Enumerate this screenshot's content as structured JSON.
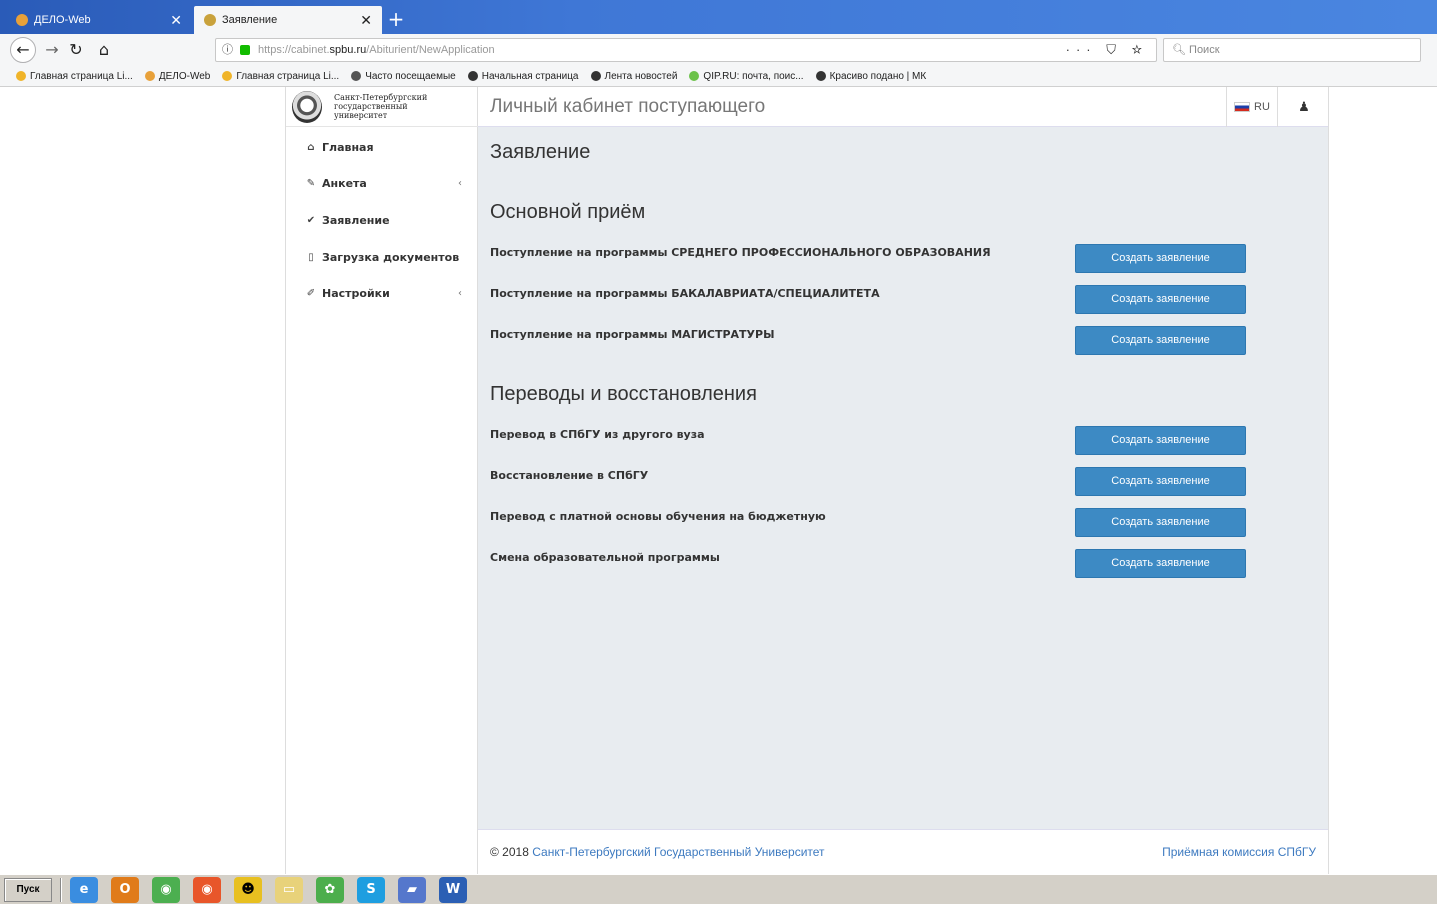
{
  "browser": {
    "tabs": [
      {
        "title": "ДЕЛО-Web",
        "active": false,
        "icon": "delo-icon"
      },
      {
        "title": "Заявление",
        "active": true,
        "icon": "spbu-crest-icon"
      }
    ],
    "url_prefix": "https://cabinet.",
    "url_host": "spbu.ru",
    "url_path": "/Abiturient/NewApplication",
    "search_placeholder": "Поиск",
    "bookmarks": [
      "Главная страница Li...",
      "ДЕЛО-Web",
      "Главная страница Li...",
      "Часто посещаемые",
      "Начальная страница",
      "Лента новостей",
      "QIP.RU: почта, поис...",
      "Красиво подано | МК"
    ]
  },
  "site": {
    "logo_text": "Санкт-Петербургский государственный университет",
    "cabinet_title": "Личный кабинет поступающего",
    "language": "RU"
  },
  "menu": [
    {
      "label": "Главная",
      "icon": "home-icon"
    },
    {
      "label": "Анкета",
      "icon": "edit-icon",
      "chevron": "‹"
    },
    {
      "label": "Заявление",
      "icon": "check-icon"
    },
    {
      "label": "Загрузка документов",
      "icon": "pdf-icon"
    },
    {
      "label": "Настройки",
      "icon": "wrench-icon",
      "chevron": "‹"
    }
  ],
  "main": {
    "page_title": "Заявление",
    "sections": [
      {
        "title": "Основной приём",
        "rows": [
          {
            "label": "Поступление на программы СРЕДНЕГО ПРОФЕССИОНАЛЬНОГО ОБРАЗОВАНИЯ",
            "button": "Создать заявление"
          },
          {
            "label": "Поступление на программы БАКАЛАВРИАТА/СПЕЦИАЛИТЕТА",
            "button": "Создать заявление"
          },
          {
            "label": "Поступление на программы МАГИСТРАТУРЫ",
            "button": "Создать заявление"
          }
        ]
      },
      {
        "title": "Переводы и восстановления",
        "rows": [
          {
            "label": "Перевод в СПбГУ из другого вуза",
            "button": "Создать заявление"
          },
          {
            "label": "Восстановление в СПбГУ",
            "button": "Создать заявление"
          },
          {
            "label": "Перевод с платной основы обучения на бюджетную",
            "button": "Создать заявление"
          },
          {
            "label": "Смена образовательной программы",
            "button": "Создать заявление"
          }
        ]
      }
    ]
  },
  "footer": {
    "copyright": "© 2018",
    "university_link": "Санкт-Петербургский Государственный Университет",
    "admissions_link": "Приёмная комиссия СПбГУ"
  },
  "taskbar": {
    "start_label": "Пуск"
  },
  "colors": {
    "accent_button": "#3d8ac4",
    "link": "#3d7ac0",
    "content_bg": "#e8ecf0"
  }
}
